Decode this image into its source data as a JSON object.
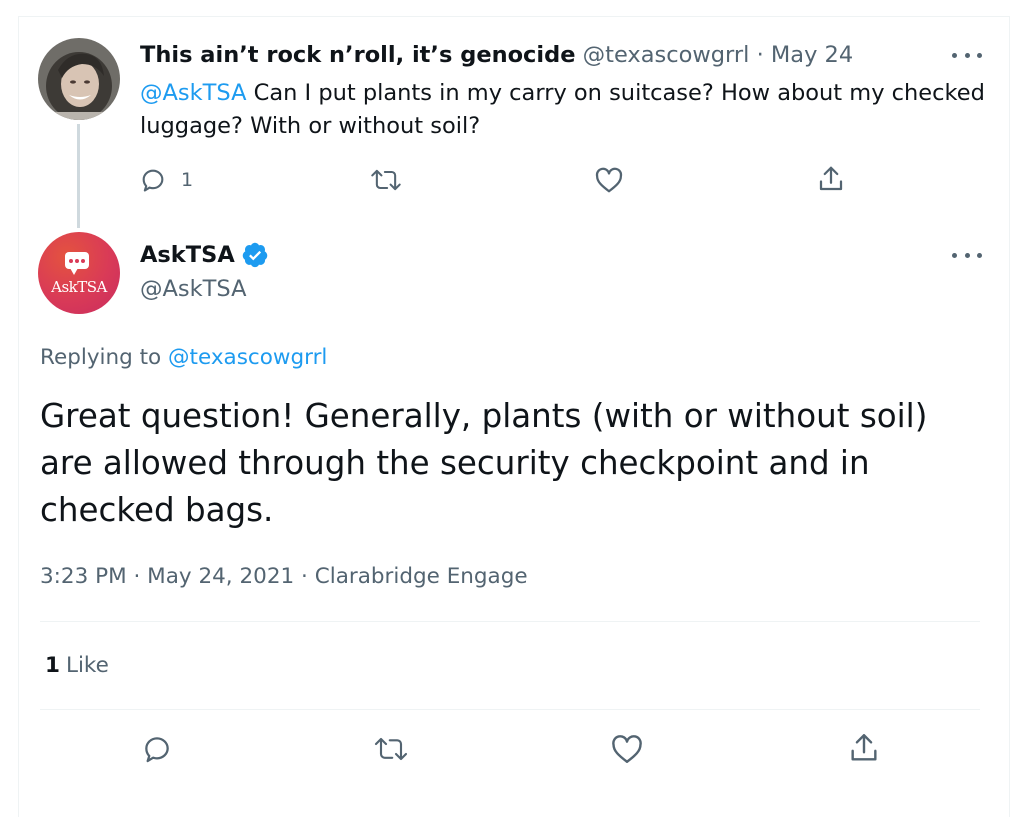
{
  "parent_tweet": {
    "author_name": "This ain’t rock n’roll, it’s genocide",
    "handle": "@texascowgrrl",
    "separator": "·",
    "date": "May 24",
    "mention": "@AskTSA",
    "text": " Can I put plants in my carry on suitcase? How about my checked luggage? With or without soil?",
    "reply_count": "1"
  },
  "main_tweet": {
    "avatar_label": "AskTSA",
    "author_name": "AskTSA",
    "handle": "@AskTSA",
    "replying_prefix": "Replying to ",
    "replying_handle": "@texascowgrrl",
    "text": "Great question! Generally, plants (with or without soil) are allowed through the security checkpoint and in checked bags.",
    "time": "3:23 PM",
    "date": "May 24, 2021",
    "source": "Clarabridge Engage",
    "meta_separator": " · ",
    "like_count": "1",
    "like_label": "Like"
  },
  "colors": {
    "link": "#1d9bf0",
    "secondary_text": "#536471",
    "primary_text": "#0f1419",
    "verified": "#1d9bf0"
  },
  "icons": {
    "reply": "reply-icon",
    "retweet": "retweet-icon",
    "like": "heart-icon",
    "share": "share-icon",
    "more": "more-icon",
    "verified": "verified-badge-icon"
  }
}
